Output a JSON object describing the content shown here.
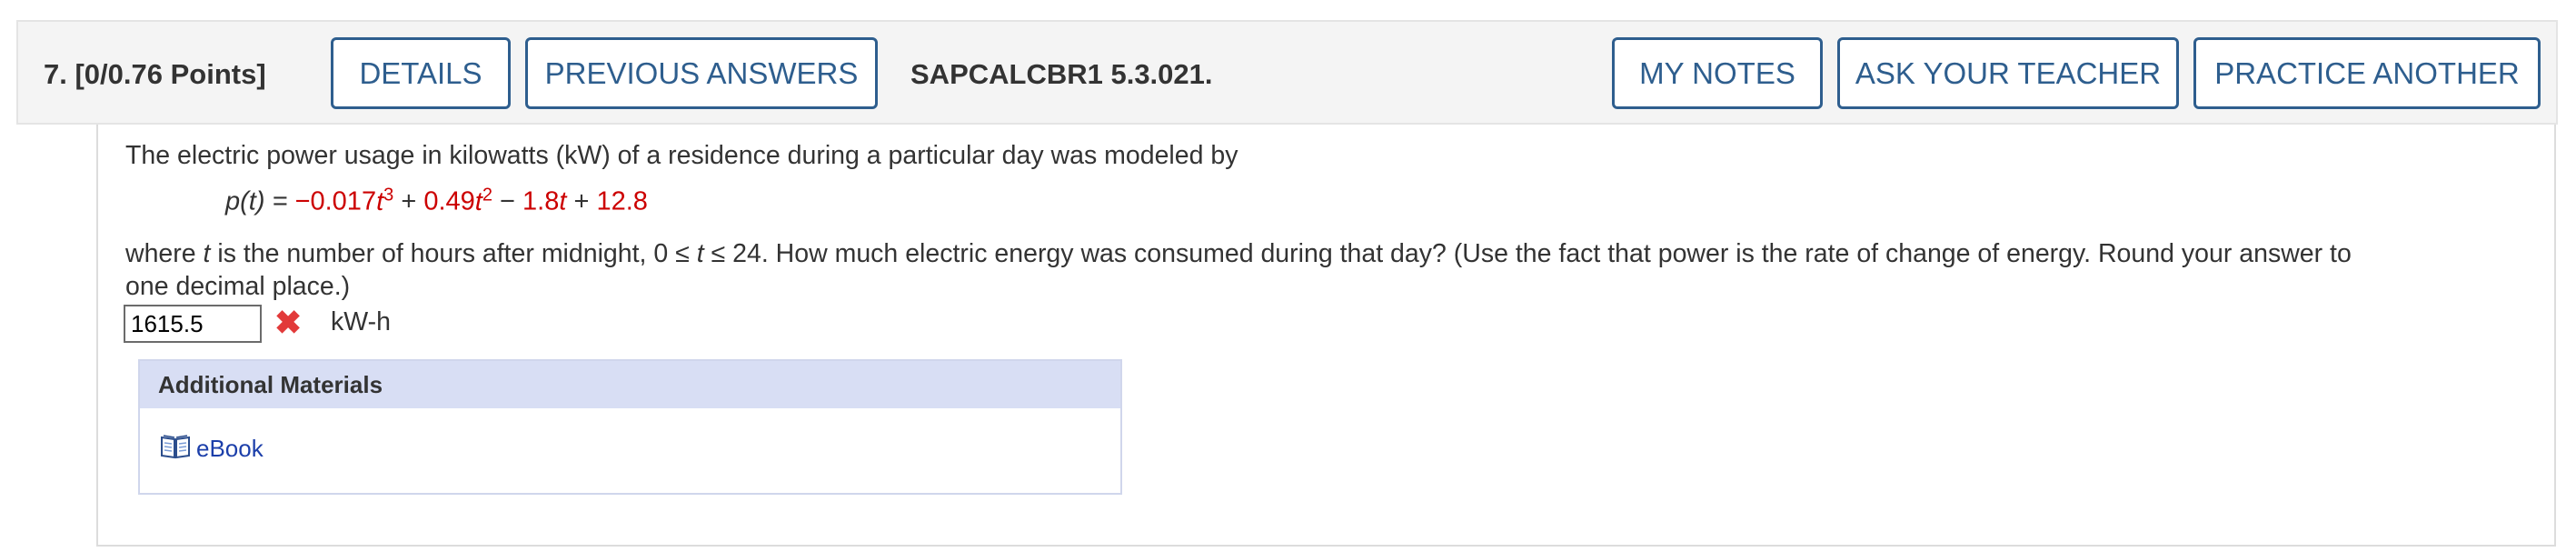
{
  "question": {
    "number": "7.",
    "points": "[0/0.76 Points]",
    "code": "SAPCALCBR1 5.3.021."
  },
  "buttons": {
    "details": "DETAILS",
    "previous_answers": "PREVIOUS ANSWERS",
    "my_notes": "MY NOTES",
    "ask_teacher": "ASK YOUR TEACHER",
    "practice_another": "PRACTICE ANOTHER"
  },
  "problem": {
    "intro": "The electric power usage in kilowatts (kW) of a residence during a particular day was modeled by",
    "formula": {
      "lhs": "p(t) = ",
      "c3": "−0.017",
      "c2": "0.49",
      "c1": "1.8",
      "c0": "12.8"
    },
    "where_prefix": "where ",
    "var": "t",
    "where_mid": " is the number of hours after midnight,  0 ≤ ",
    "where_suffix": " ≤ 24.  How much electric energy was consumed during that day? (Use the fact that power is the rate of change of energy. Round your answer to",
    "line3": "one decimal place.)"
  },
  "answer": {
    "value": "1615.5",
    "status": "incorrect",
    "unit": "kW-h"
  },
  "additional_materials": {
    "title": "Additional Materials",
    "ebook_label": "eBook"
  },
  "colors": {
    "button_blue": "#2e5e8e",
    "coef_red": "#cc0000",
    "materials_header": "#d8def4",
    "link_blue": "#1c3faa"
  }
}
